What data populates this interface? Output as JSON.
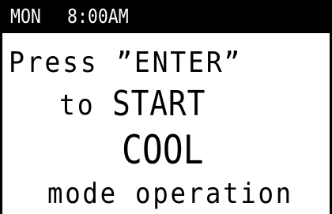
{
  "status": {
    "day": "MON",
    "time": "8:00AM"
  },
  "message": {
    "line1": "Press ”ENTER”",
    "line2_prefix": "to",
    "line2_action": "START",
    "mode": "COOL",
    "line4": "mode operation"
  },
  "colors": {
    "status_bar_bg": "#000000",
    "status_bar_text": "#ffffff",
    "screen_bg": "#ffffff",
    "text": "#000000"
  }
}
